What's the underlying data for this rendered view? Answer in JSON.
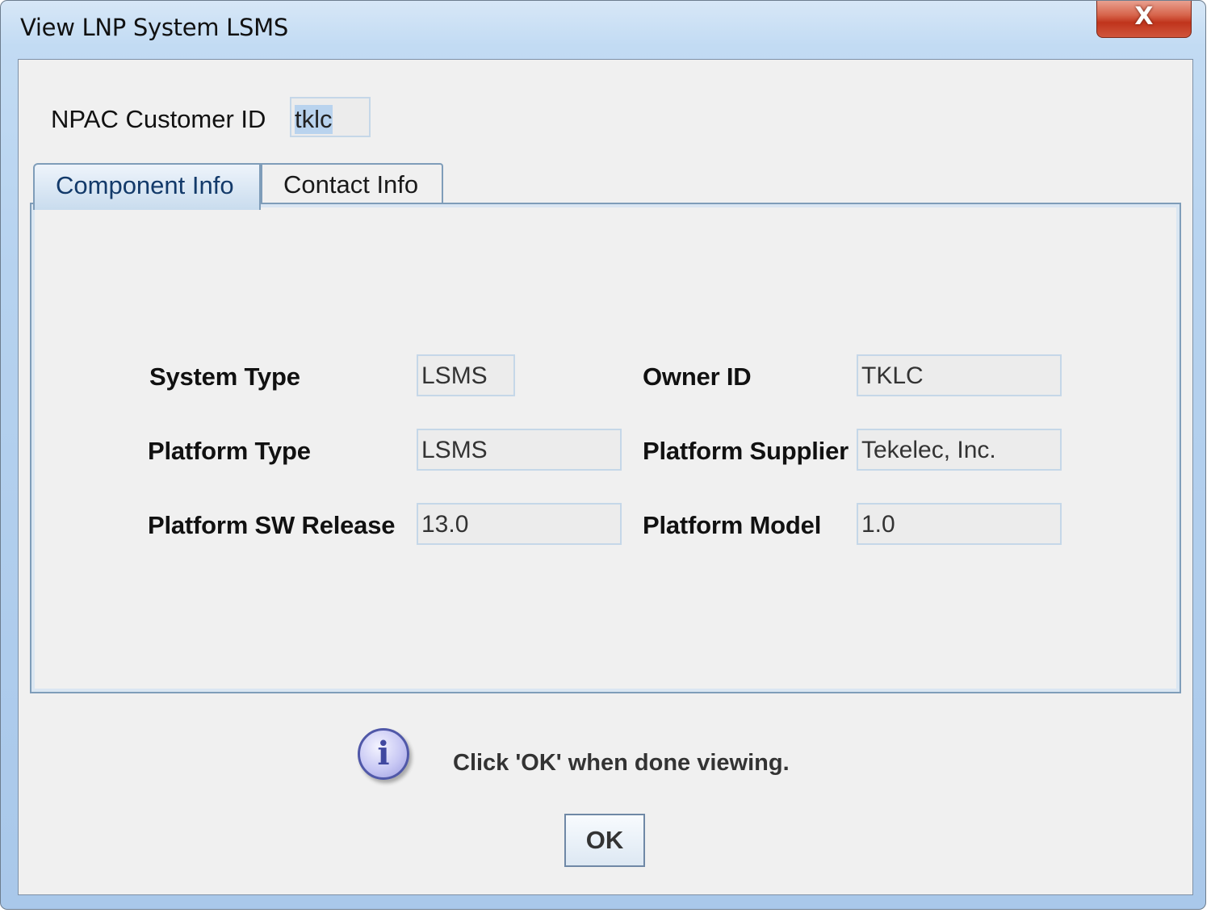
{
  "window": {
    "title": "View LNP System LSMS",
    "close_label": "X"
  },
  "customer": {
    "label": "NPAC Customer ID",
    "value": "tklc"
  },
  "tabs": [
    {
      "label": "Component Info",
      "selected": true
    },
    {
      "label": "Contact Info",
      "selected": false
    }
  ],
  "component_info": {
    "system_type": {
      "label": "System Type",
      "value": "LSMS"
    },
    "platform_type": {
      "label": "Platform Type",
      "value": "LSMS"
    },
    "platform_sw_release": {
      "label": "Platform SW Release",
      "value": "13.0"
    },
    "owner_id": {
      "label": "Owner ID",
      "value": "TKLC"
    },
    "platform_supplier": {
      "label": "Platform Supplier",
      "value": "Tekelec, Inc."
    },
    "platform_model": {
      "label": "Platform Model",
      "value": "1.0"
    }
  },
  "status": {
    "icon": "info-icon",
    "icon_glyph": "i",
    "message": "Click 'OK' when done viewing."
  },
  "buttons": {
    "ok_label": "OK"
  }
}
